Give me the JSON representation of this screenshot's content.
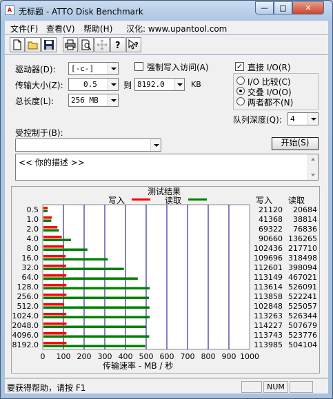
{
  "window": {
    "title": "无标题 - ATTO Disk Benchmark",
    "app_icon": "A"
  },
  "controls": {
    "minimize": "—",
    "maximize": "□",
    "close": "✕"
  },
  "menu": [
    {
      "label": "文件(F)"
    },
    {
      "label": "查看(V)"
    },
    {
      "label": "帮助(H)"
    },
    {
      "label": "汉化: www.upantool.com"
    }
  ],
  "toolbar": [
    "new-file-icon",
    "open-folder-icon",
    "save-icon",
    "print-icon",
    "print-preview-icon",
    "move-icon",
    "help-icon",
    "context-help-icon"
  ],
  "settings": {
    "drive_label": "驱动器(D):",
    "drive_value": "[-c-]",
    "force_write_label": "强制写入访问(A)",
    "force_write_checked": false,
    "direct_io_label": "直接 I/O(R)",
    "direct_io_checked": true,
    "transfer_label": "传输大小(Z):",
    "transfer_from": "0.5",
    "to_label": "到",
    "transfer_to": "8192.0",
    "kb_label": "KB",
    "length_label": "总长度(L):",
    "length_value": "256 MB",
    "io_compare_label": "I/O 比较(C)",
    "overlapped_io_label": "交叠 I/O(O)",
    "neither_label": "两者都不(N)",
    "io_mode_selected": "overlapped",
    "queue_label": "队列深度(Q):",
    "queue_value": "4",
    "controlled_label": "受控制于(B):",
    "controlled_value": "",
    "start_button": "开始(S)"
  },
  "description": {
    "text": "<<  你的描述   >>"
  },
  "results": {
    "title": "测试结果",
    "write_legend": "写入",
    "read_legend": "读取",
    "write_col": "写入",
    "read_col": "读取",
    "rows": [
      {
        "size": "0.5",
        "write": "21120",
        "read": "20684"
      },
      {
        "size": "1.0",
        "write": "41368",
        "read": "38814"
      },
      {
        "size": "2.0",
        "write": "69322",
        "read": "76836"
      },
      {
        "size": "4.0",
        "write": "90660",
        "read": "136265"
      },
      {
        "size": "8.0",
        "write": "102436",
        "read": "217710"
      },
      {
        "size": "16.0",
        "write": "109696",
        "read": "318498"
      },
      {
        "size": "32.0",
        "write": "112601",
        "read": "398094"
      },
      {
        "size": "64.0",
        "write": "113149",
        "read": "467021"
      },
      {
        "size": "128.0",
        "write": "113614",
        "read": "526091"
      },
      {
        "size": "256.0",
        "write": "113858",
        "read": "522241"
      },
      {
        "size": "512.0",
        "write": "102848",
        "read": "525057"
      },
      {
        "size": "1024.0",
        "write": "113263",
        "read": "526344"
      },
      {
        "size": "2048.0",
        "write": "114227",
        "read": "507679"
      },
      {
        "size": "4096.0",
        "write": "113743",
        "read": "523776"
      },
      {
        "size": "8192.0",
        "write": "113985",
        "read": "504104"
      }
    ],
    "xlabel": "传输速率 - MB / 秒"
  },
  "chart_data": {
    "type": "bar",
    "orientation": "horizontal",
    "categories": [
      "0.5",
      "1.0",
      "2.0",
      "4.0",
      "8.0",
      "16.0",
      "32.0",
      "64.0",
      "128.0",
      "256.0",
      "512.0",
      "1024.0",
      "2048.0",
      "4096.0",
      "8192.0"
    ],
    "series": [
      {
        "name": "写入",
        "color": "#ff0000",
        "values": [
          20.6,
          40.4,
          67.7,
          88.5,
          100.0,
          107.1,
          110.0,
          110.5,
          111.0,
          111.2,
          100.4,
          110.6,
          111.5,
          111.1,
          111.3
        ]
      },
      {
        "name": "读取",
        "color": "#008000",
        "values": [
          20.2,
          37.9,
          75.0,
          133.1,
          212.6,
          311.0,
          388.8,
          456.1,
          513.8,
          510.0,
          512.8,
          514.0,
          495.8,
          511.5,
          492.3
        ]
      }
    ],
    "xlim": [
      0,
      1000
    ],
    "xticks": [
      "0",
      "100",
      "200",
      "300",
      "400",
      "500",
      "600",
      "700",
      "800",
      "900",
      "1000"
    ],
    "xlabel": "传输速率 - MB / 秒",
    "legend": "top"
  },
  "status": {
    "text": "要获得帮助，请按 F1",
    "num": "NUM"
  }
}
